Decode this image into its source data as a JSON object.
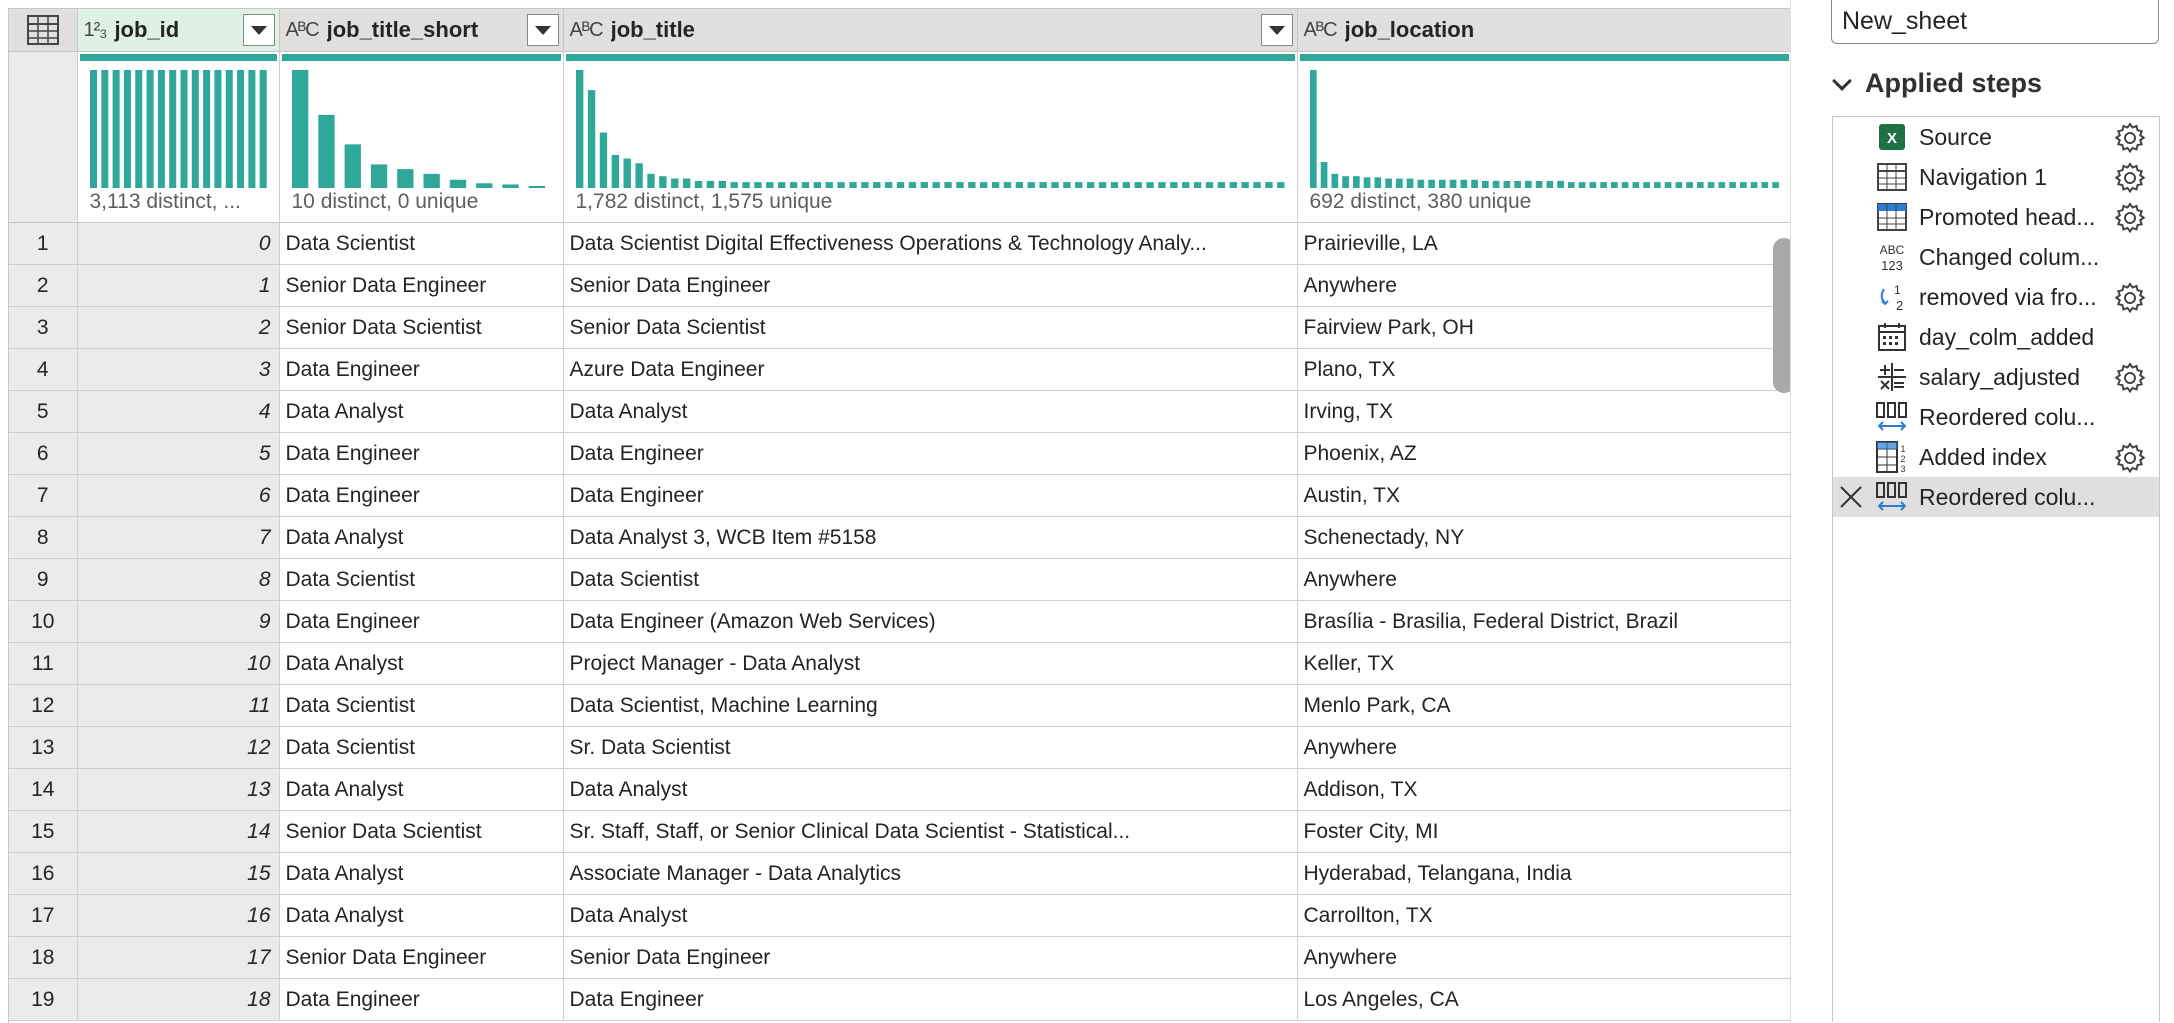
{
  "table": {
    "columns": [
      {
        "name": "job_id",
        "type_icon": "1²₃",
        "type": "whole-number",
        "dropdown": true,
        "selected": true
      },
      {
        "name": "job_title_short",
        "type_icon": "AᴮC",
        "type": "text",
        "dropdown": true
      },
      {
        "name": "job_title",
        "type_icon": "AᴮC",
        "type": "text",
        "dropdown": true
      },
      {
        "name": "job_location",
        "type_icon": "AᴮC",
        "type": "text",
        "dropdown": false
      }
    ],
    "profiles": [
      {
        "text": "3,113 distinct, ...",
        "histogram": [
          1,
          1,
          1,
          1,
          1,
          1,
          1,
          1,
          1,
          1,
          1,
          1,
          1,
          1,
          1,
          1
        ]
      },
      {
        "text": "10 distinct, 0 unique",
        "histogram": [
          1.0,
          0.62,
          0.37,
          0.2,
          0.16,
          0.12,
          0.07,
          0.04,
          0.03,
          0.01
        ]
      },
      {
        "text": "1,782 distinct, 1,575 unique",
        "histogram": [
          1.0,
          0.83,
          0.47,
          0.28,
          0.25,
          0.21,
          0.12,
          0.1,
          0.08,
          0.08,
          0.06,
          0.06,
          0.06,
          0.05,
          0.05,
          0.05,
          0.05,
          0.05,
          0.05,
          0.05,
          0.05,
          0.05,
          0.05,
          0.05,
          0.05,
          0.05,
          0.05,
          0.05,
          0.05,
          0.05,
          0.05,
          0.05,
          0.05,
          0.05,
          0.05,
          0.05,
          0.05,
          0.05,
          0.05,
          0.05,
          0.05,
          0.05,
          0.05,
          0.05,
          0.05,
          0.05,
          0.05,
          0.05,
          0.05,
          0.05,
          0.05,
          0.05,
          0.05,
          0.05,
          0.05,
          0.05,
          0.05,
          0.05,
          0.05,
          0.05
        ]
      },
      {
        "text": "692 distinct, 380 unique",
        "histogram": [
          1.0,
          0.22,
          0.12,
          0.1,
          0.1,
          0.09,
          0.09,
          0.08,
          0.08,
          0.08,
          0.07,
          0.07,
          0.07,
          0.07,
          0.07,
          0.07,
          0.06,
          0.06,
          0.06,
          0.06,
          0.06,
          0.06,
          0.06,
          0.06,
          0.05,
          0.05,
          0.05,
          0.05,
          0.05,
          0.05,
          0.05,
          0.05,
          0.05,
          0.05,
          0.05,
          0.05,
          0.05,
          0.05,
          0.05,
          0.05,
          0.05,
          0.05,
          0.05,
          0.05
        ]
      }
    ],
    "rows": [
      {
        "idx": "1",
        "job_id": "0",
        "job_title_short": "Data Scientist",
        "job_title": "Data Scientist Digital Effectiveness Operations & Technology Analy...",
        "job_location": "Prairieville, LA"
      },
      {
        "idx": "2",
        "job_id": "1",
        "job_title_short": "Senior Data Engineer",
        "job_title": "Senior Data Engineer",
        "job_location": "Anywhere"
      },
      {
        "idx": "3",
        "job_id": "2",
        "job_title_short": "Senior Data Scientist",
        "job_title": "Senior Data Scientist",
        "job_location": "Fairview Park, OH"
      },
      {
        "idx": "4",
        "job_id": "3",
        "job_title_short": "Data Engineer",
        "job_title": "Azure Data Engineer",
        "job_location": "Plano, TX"
      },
      {
        "idx": "5",
        "job_id": "4",
        "job_title_short": "Data Analyst",
        "job_title": "Data Analyst",
        "job_location": "Irving, TX"
      },
      {
        "idx": "6",
        "job_id": "5",
        "job_title_short": "Data Engineer",
        "job_title": "Data Engineer",
        "job_location": "Phoenix, AZ"
      },
      {
        "idx": "7",
        "job_id": "6",
        "job_title_short": "Data Engineer",
        "job_title": "Data Engineer",
        "job_location": "Austin, TX"
      },
      {
        "idx": "8",
        "job_id": "7",
        "job_title_short": "Data Analyst",
        "job_title": "Data Analyst 3, WCB Item #5158",
        "job_location": "Schenectady, NY"
      },
      {
        "idx": "9",
        "job_id": "8",
        "job_title_short": "Data Scientist",
        "job_title": "Data Scientist",
        "job_location": "Anywhere"
      },
      {
        "idx": "10",
        "job_id": "9",
        "job_title_short": "Data Engineer",
        "job_title": "Data Engineer (Amazon Web Services)",
        "job_location": "Brasília - Brasilia, Federal District, Brazil"
      },
      {
        "idx": "11",
        "job_id": "10",
        "job_title_short": "Data Analyst",
        "job_title": "Project Manager - Data Analyst",
        "job_location": "Keller, TX"
      },
      {
        "idx": "12",
        "job_id": "11",
        "job_title_short": "Data Scientist",
        "job_title": "Data Scientist, Machine Learning",
        "job_location": "Menlo Park, CA"
      },
      {
        "idx": "13",
        "job_id": "12",
        "job_title_short": "Data Scientist",
        "job_title": "Sr. Data Scientist",
        "job_location": "Anywhere"
      },
      {
        "idx": "14",
        "job_id": "13",
        "job_title_short": "Data Analyst",
        "job_title": "Data Analyst",
        "job_location": "Addison, TX"
      },
      {
        "idx": "15",
        "job_id": "14",
        "job_title_short": "Senior Data Scientist",
        "job_title": "Sr. Staff, Staff, or Senior Clinical Data Scientist - Statistical...",
        "job_location": "Foster City, MI"
      },
      {
        "idx": "16",
        "job_id": "15",
        "job_title_short": "Data Analyst",
        "job_title": "Associate Manager - Data Analytics",
        "job_location": "Hyderabad, Telangana, India"
      },
      {
        "idx": "17",
        "job_id": "16",
        "job_title_short": "Data Analyst",
        "job_title": "Data Analyst",
        "job_location": "Carrollton, TX"
      },
      {
        "idx": "18",
        "job_id": "17",
        "job_title_short": "Senior Data Engineer",
        "job_title": "Senior Data Engineer",
        "job_location": "Anywhere"
      },
      {
        "idx": "19",
        "job_id": "18",
        "job_title_short": "Data Engineer",
        "job_title": "Data Engineer",
        "job_location": "Los Angeles, CA"
      }
    ]
  },
  "query_settings": {
    "name_value": "New_sheet",
    "applied_steps_label": "Applied steps",
    "steps": [
      {
        "label": "Source",
        "icon": "excel-icon",
        "has_settings": true,
        "active": false
      },
      {
        "label": "Navigation 1",
        "icon": "table-icon",
        "has_settings": true,
        "active": false
      },
      {
        "label": "Promoted head...",
        "icon": "promoted-headers-icon",
        "has_settings": true,
        "active": false
      },
      {
        "label": "Changed colum...",
        "icon": "type-abc-123-icon",
        "has_settings": false,
        "active": false
      },
      {
        "label": "removed via fro...",
        "icon": "replace-values-icon",
        "has_settings": true,
        "active": false
      },
      {
        "label": "day_colm_added",
        "icon": "calendar-icon",
        "has_settings": false,
        "active": false
      },
      {
        "label": "salary_adjusted",
        "icon": "calculator-icon",
        "has_settings": true,
        "active": false
      },
      {
        "label": "Reordered colu...",
        "icon": "reorder-columns-icon",
        "has_settings": false,
        "active": false
      },
      {
        "label": "Added index",
        "icon": "index-column-icon",
        "has_settings": true,
        "active": false
      },
      {
        "label": "Reordered colu...",
        "icon": "reorder-columns-icon",
        "has_settings": false,
        "active": true
      }
    ]
  },
  "colors": {
    "accent_teal": "#2fa89a",
    "selected_header": "#dff0e5",
    "excel_green": "#1e7145"
  }
}
